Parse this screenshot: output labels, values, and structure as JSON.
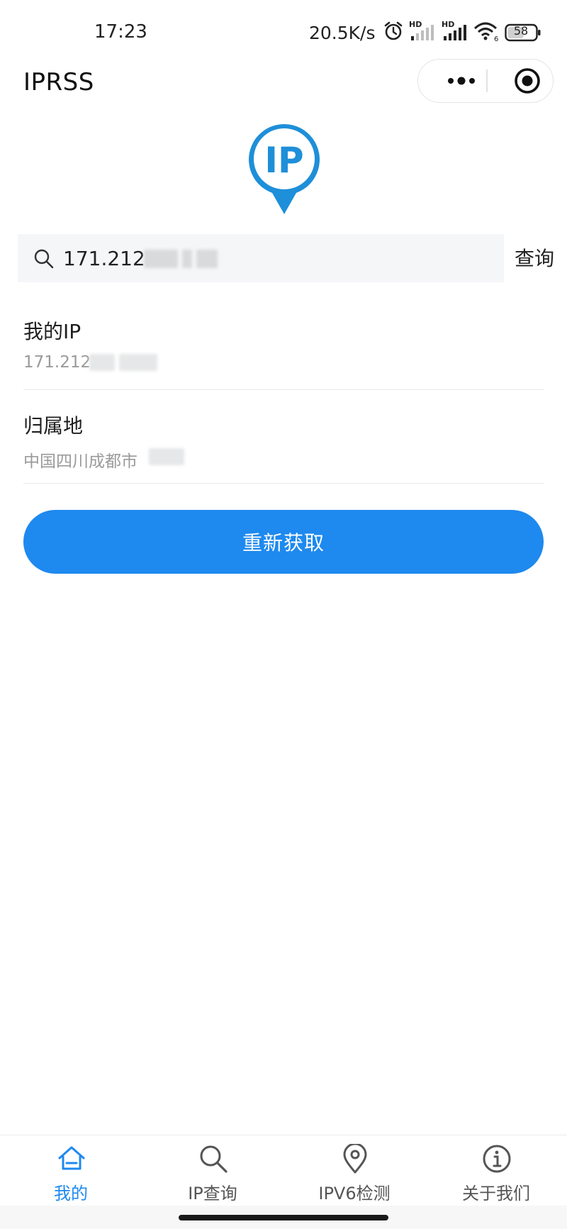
{
  "status_bar": {
    "time": "17:23",
    "net_speed": "20.5K/s",
    "icons": [
      "alarm-icon",
      "signal-hd-icon",
      "signal-hd-icon",
      "wifi-icon",
      "battery-icon"
    ],
    "hd_label": "HD",
    "wifi_badge": "6",
    "battery": "58"
  },
  "header": {
    "title": "IPRSS",
    "capsule_icons": [
      "more-icon",
      "target-icon"
    ]
  },
  "logo": {
    "text": "IP",
    "color": "#1e8fd9"
  },
  "search": {
    "value": "171.212.",
    "action_label": "查询",
    "icon": "search-icon"
  },
  "info": {
    "items": [
      {
        "label": "我的IP",
        "value": "171.212"
      },
      {
        "label": "归属地",
        "value": "中国四川成都市"
      }
    ]
  },
  "refresh_button": {
    "label": "重新获取",
    "color": "#1e89ef"
  },
  "tabbar": {
    "active_color": "#1e89ef",
    "items": [
      {
        "label": "我的",
        "icon": "home-icon",
        "active": true
      },
      {
        "label": "IP查询",
        "icon": "search-icon",
        "active": false
      },
      {
        "label": "IPV6检测",
        "icon": "location-pin-icon",
        "active": false
      },
      {
        "label": "关于我们",
        "icon": "info-icon",
        "active": false
      }
    ]
  }
}
